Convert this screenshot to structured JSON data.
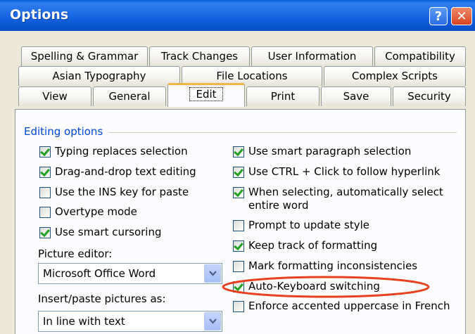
{
  "window": {
    "title": "Options"
  },
  "tabs": {
    "row1": [
      "Spelling & Grammar",
      "Track Changes",
      "User Information",
      "Compatibility"
    ],
    "row2": [
      "Asian Typography",
      "File Locations",
      "Complex Scripts"
    ],
    "row3": [
      "View",
      "General",
      "Edit",
      "Print",
      "Save",
      "Security"
    ],
    "selected": "Edit"
  },
  "editing": {
    "group_label": "Editing options",
    "left": [
      {
        "label": "Typing replaces selection",
        "checked": true
      },
      {
        "label": "Drag-and-drop text editing",
        "checked": true
      },
      {
        "label": "Use the INS key for paste",
        "checked": false
      },
      {
        "label": "Overtype mode",
        "checked": false
      },
      {
        "label": "Use smart cursoring",
        "checked": true
      }
    ],
    "picture_editor_label": "Picture editor:",
    "picture_editor_value": "Microsoft Office Word",
    "insert_as_label": "Insert/paste pictures as:",
    "insert_as_value": "In line with text",
    "right": [
      {
        "label": "Use smart paragraph selection",
        "checked": true
      },
      {
        "label": "Use CTRL + Click to follow hyperlink",
        "checked": true
      },
      {
        "label": "When selecting, automatically select",
        "label2": "entire word",
        "checked": true
      },
      {
        "label": "Prompt to update style",
        "checked": false
      },
      {
        "label": "Keep track of formatting",
        "checked": true
      },
      {
        "label": "Mark formatting inconsistencies",
        "checked": false
      },
      {
        "label": "Auto-Keyboard switching",
        "checked": true
      },
      {
        "label": "Enforce accented uppercase in French",
        "checked": false
      }
    ]
  },
  "colors": {
    "title_bar": "#0a56d4",
    "group_label": "#0046d5",
    "highlight_ellipse": "#e8401c",
    "check": "#21a121"
  }
}
